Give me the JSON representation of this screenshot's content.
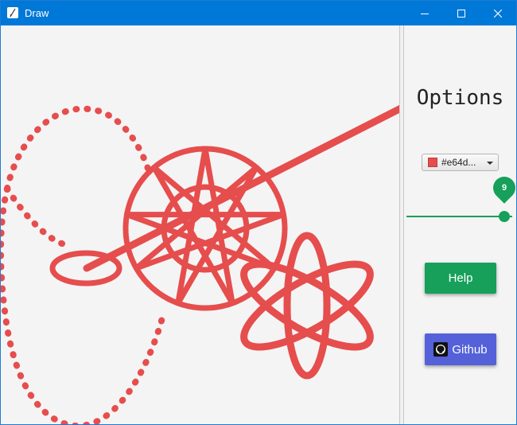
{
  "window": {
    "title": "Draw"
  },
  "drawing": {
    "stroke_color": "#e64d4d"
  },
  "options": {
    "title": "Options",
    "color_label": "#e64d...",
    "color_value": "#e64d4d",
    "size_value": "9",
    "help_label": "Help",
    "github_label": "Github"
  },
  "colors": {
    "titlebar": "#0078d7",
    "help_button": "#16a05a",
    "github_button": "#5461d8",
    "slider": "#16a05a"
  },
  "icons": [
    "app-icon",
    "minimize-icon",
    "maximize-icon",
    "close-icon",
    "dropdown-arrow-icon",
    "github-icon"
  ]
}
